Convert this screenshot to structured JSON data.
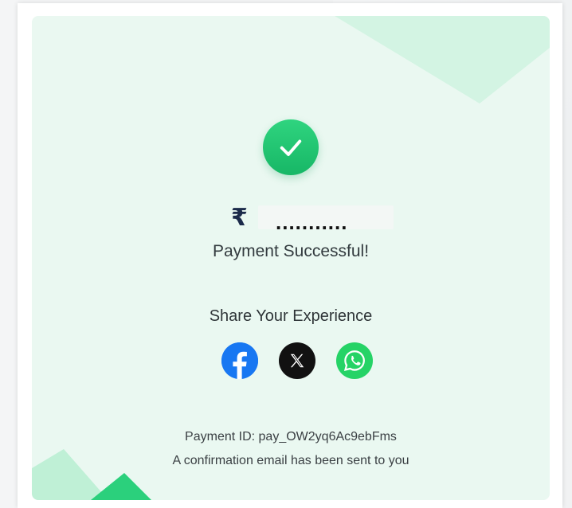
{
  "colors": {
    "card_background": "#eaf8f1",
    "accent_green": "#1fc16f",
    "facebook_blue": "#1877f2",
    "x_black": "#111111",
    "whatsapp_green": "#25d366"
  },
  "payment": {
    "currency_symbol": "₹",
    "amount_placeholder": "...........",
    "status": "Payment Successful!",
    "status_icon": "check-circle-icon"
  },
  "share": {
    "title": "Share Your Experience",
    "buttons": [
      {
        "icon": "facebook-icon"
      },
      {
        "icon": "x-icon"
      },
      {
        "icon": "whatsapp-icon"
      }
    ]
  },
  "footer": {
    "payment_id": "Payment ID: pay_OW2yq6Ac9ebFms",
    "confirmation": "A confirmation email has been sent to you"
  }
}
